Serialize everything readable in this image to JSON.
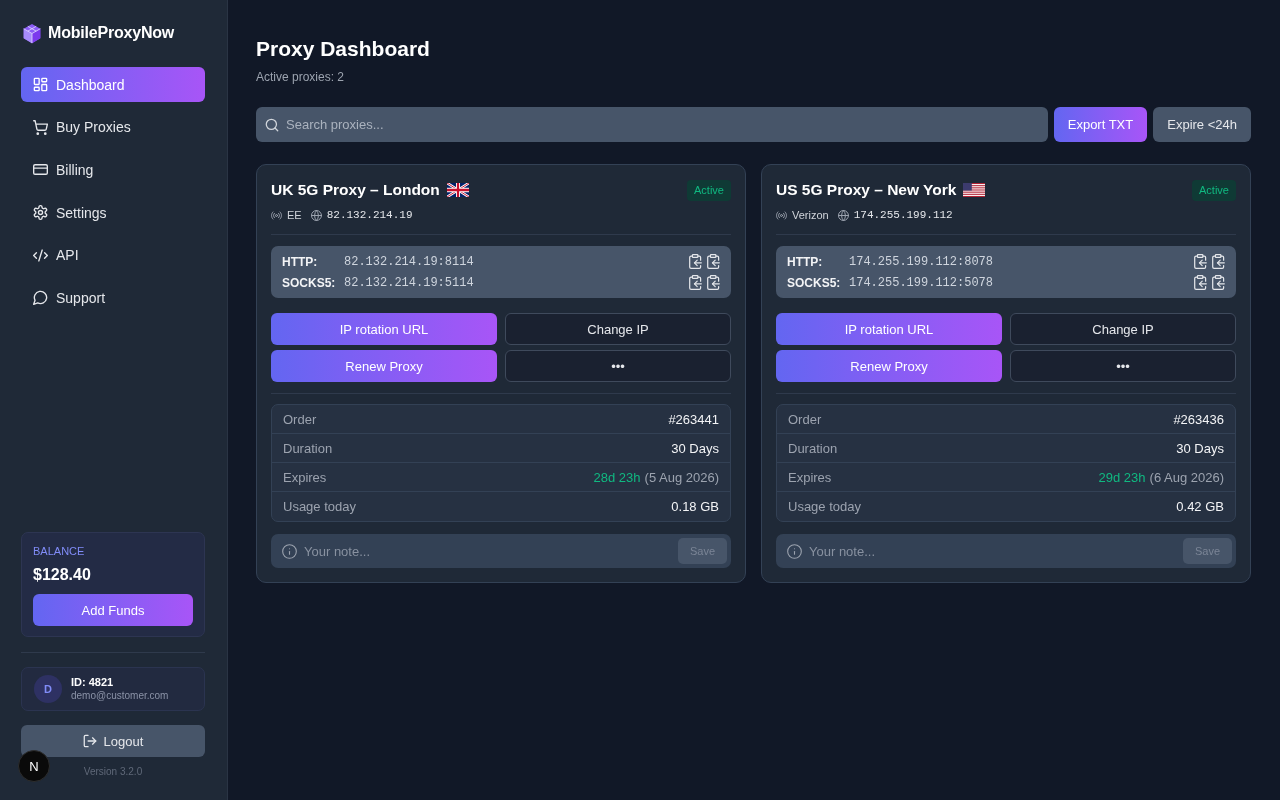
{
  "sidebar": {
    "brand": "MobileProxyNow",
    "nav": [
      {
        "label": "Dashboard",
        "kind": "dashboard",
        "selected": true
      },
      {
        "label": "Buy Proxies",
        "kind": "cart",
        "selected": false
      },
      {
        "label": "Billing",
        "kind": "billing",
        "selected": false
      },
      {
        "label": "Settings",
        "kind": "settings",
        "selected": false
      },
      {
        "label": "API",
        "kind": "api",
        "selected": false
      },
      {
        "label": "Support",
        "kind": "support",
        "selected": false
      }
    ],
    "balance": {
      "label": "BALANCE",
      "amount": "$128.40",
      "button": "Add Funds"
    },
    "account": {
      "avatar": "D",
      "id": "ID: 4821",
      "email": "demo@customer.com"
    },
    "logout": "Logout",
    "version": "Version 3.2.0"
  },
  "dev_badge": "N",
  "header": {
    "title": "Proxy Dashboard",
    "subtitle": "Active proxies: 2"
  },
  "toolbar": {
    "search_placeholder": "Search proxies...",
    "buttons": [
      {
        "label": "Export TXT",
        "kind": "primary"
      },
      {
        "label": "Expire <24h",
        "kind": "secondary"
      }
    ]
  },
  "proxies": [
    {
      "title": "UK 5G Proxy – London",
      "flag": {
        "kind": "uk"
      },
      "status": "Active",
      "carrier": "EE",
      "ip": "82.132.214.19",
      "endpoints": [
        {
          "label": "HTTP:",
          "address": "82.132.214.19:8114"
        },
        {
          "label": "SOCKS5:",
          "address": "82.132.214.19:5114"
        }
      ],
      "actions": [
        {
          "label": "IP rotation URL",
          "kind": "primary"
        },
        {
          "label": "Change IP",
          "kind": "outline"
        },
        {
          "label": "Renew Proxy",
          "kind": "primary"
        },
        {
          "label": "•••",
          "kind": "outline"
        }
      ],
      "details": [
        {
          "label": "Order",
          "value": "#263441",
          "kind": "plain"
        },
        {
          "label": "Duration",
          "value": "30 Days",
          "kind": "plain"
        },
        {
          "label": "Expires",
          "value": "28d 23h",
          "note": "(5 Aug 2026)",
          "kind": "countdown"
        },
        {
          "label": "Usage today",
          "value": "0.18 GB",
          "kind": "plain"
        }
      ],
      "note": {
        "placeholder": "Your note...",
        "button": "Save",
        "disabled": true
      }
    },
    {
      "title": "US 5G Proxy – New York",
      "flag": {
        "kind": "us"
      },
      "status": "Active",
      "carrier": "Verizon",
      "ip": "174.255.199.112",
      "endpoints": [
        {
          "label": "HTTP:",
          "address": "174.255.199.112:8078"
        },
        {
          "label": "SOCKS5:",
          "address": "174.255.199.112:5078"
        }
      ],
      "actions": [
        {
          "label": "IP rotation URL",
          "kind": "primary"
        },
        {
          "label": "Change IP",
          "kind": "outline"
        },
        {
          "label": "Renew Proxy",
          "kind": "primary"
        },
        {
          "label": "•••",
          "kind": "outline"
        }
      ],
      "details": [
        {
          "label": "Order",
          "value": "#263436",
          "kind": "plain"
        },
        {
          "label": "Duration",
          "value": "30 Days",
          "kind": "plain"
        },
        {
          "label": "Expires",
          "value": "29d 23h",
          "note": "(6 Aug 2026)",
          "kind": "countdown"
        },
        {
          "label": "Usage today",
          "value": "0.42 GB",
          "kind": "plain"
        }
      ],
      "note": {
        "placeholder": "Your note...",
        "button": "Save",
        "disabled": true
      }
    }
  ]
}
